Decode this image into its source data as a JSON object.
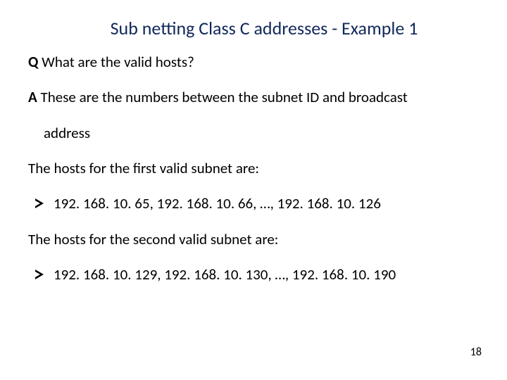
{
  "title": "Sub netting Class C addresses - Example 1",
  "q_label": "Q",
  "q_text": " What are the valid hosts?",
  "a_label": "A",
  "a_text": " These are the numbers between the subnet ID and broadcast",
  "a_text2": "address",
  "hosts1_intro": "The hosts for the first valid subnet are:",
  "hosts1_list": "192. 168. 10. 65, 192. 168. 10. 66, …, 192. 168. 10. 126",
  "hosts2_intro": "The hosts for the second valid subnet are:",
  "hosts2_list": "192. 168. 10. 129, 192. 168. 10. 130, …, 192. 168. 10. 190",
  "page_number": "18"
}
